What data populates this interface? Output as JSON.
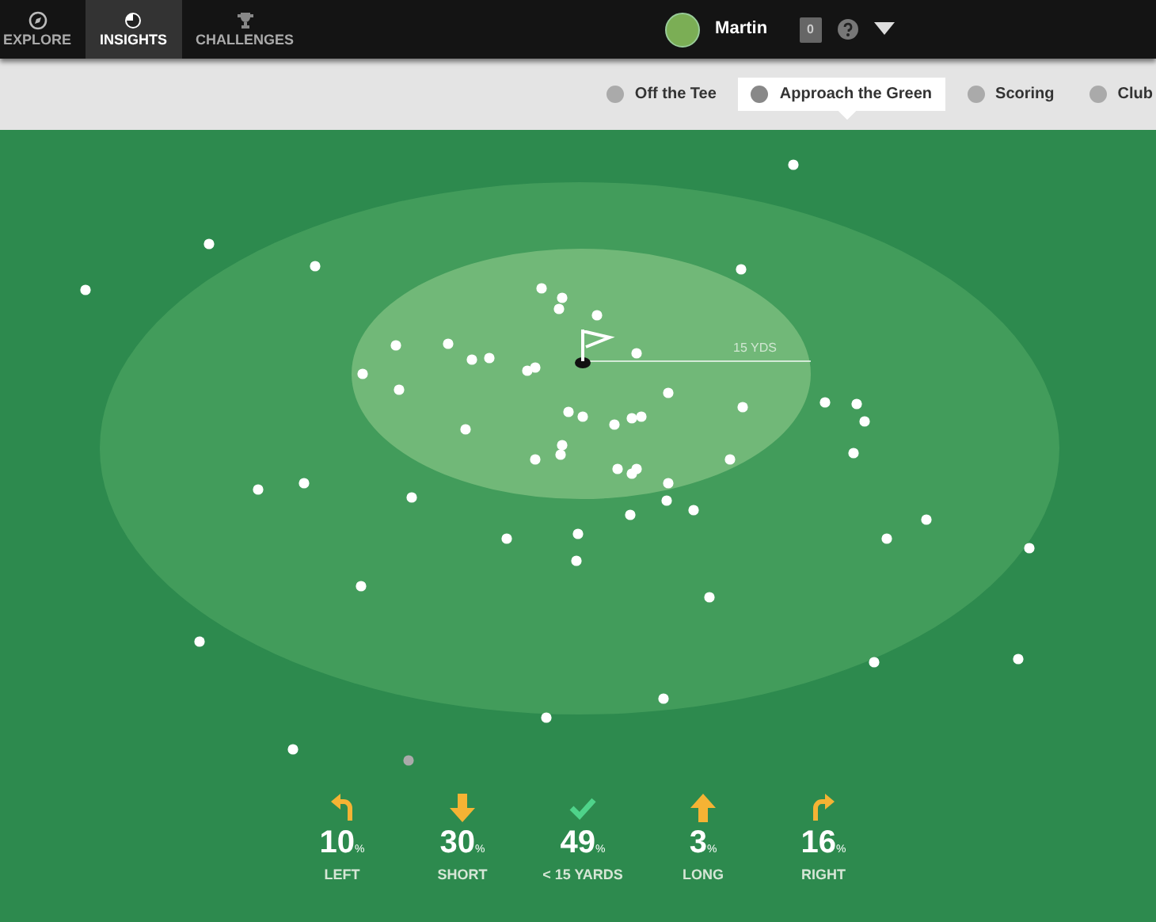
{
  "nav": {
    "tabs": [
      {
        "label": "EXPLORE",
        "kind": "compass",
        "selected": false
      },
      {
        "label": "INSIGHTS",
        "kind": "insight",
        "selected": true
      },
      {
        "label": "CHALLENGES",
        "kind": "trophy",
        "selected": false
      }
    ],
    "user": {
      "name": "Martin"
    },
    "notifications": "0"
  },
  "subnav": {
    "tabs": [
      {
        "label": "Off the Tee",
        "selected": false
      },
      {
        "label": "Approach the Green",
        "selected": true
      },
      {
        "label": "Scoring",
        "selected": false
      },
      {
        "label": "Club",
        "selected": false
      }
    ]
  },
  "green": {
    "radius_label": "15 YDS"
  },
  "stats": [
    {
      "kind": "left",
      "value": "10",
      "unit": "%",
      "label": "LEFT"
    },
    {
      "kind": "short",
      "value": "30",
      "unit": "%",
      "label": "SHORT"
    },
    {
      "kind": "inside",
      "value": "49",
      "unit": "%",
      "label": "< 15 YARDS"
    },
    {
      "kind": "long",
      "value": "3",
      "unit": "%",
      "label": "LONG"
    },
    {
      "kind": "right",
      "value": "16",
      "unit": "%",
      "label": "RIGHT"
    }
  ]
}
